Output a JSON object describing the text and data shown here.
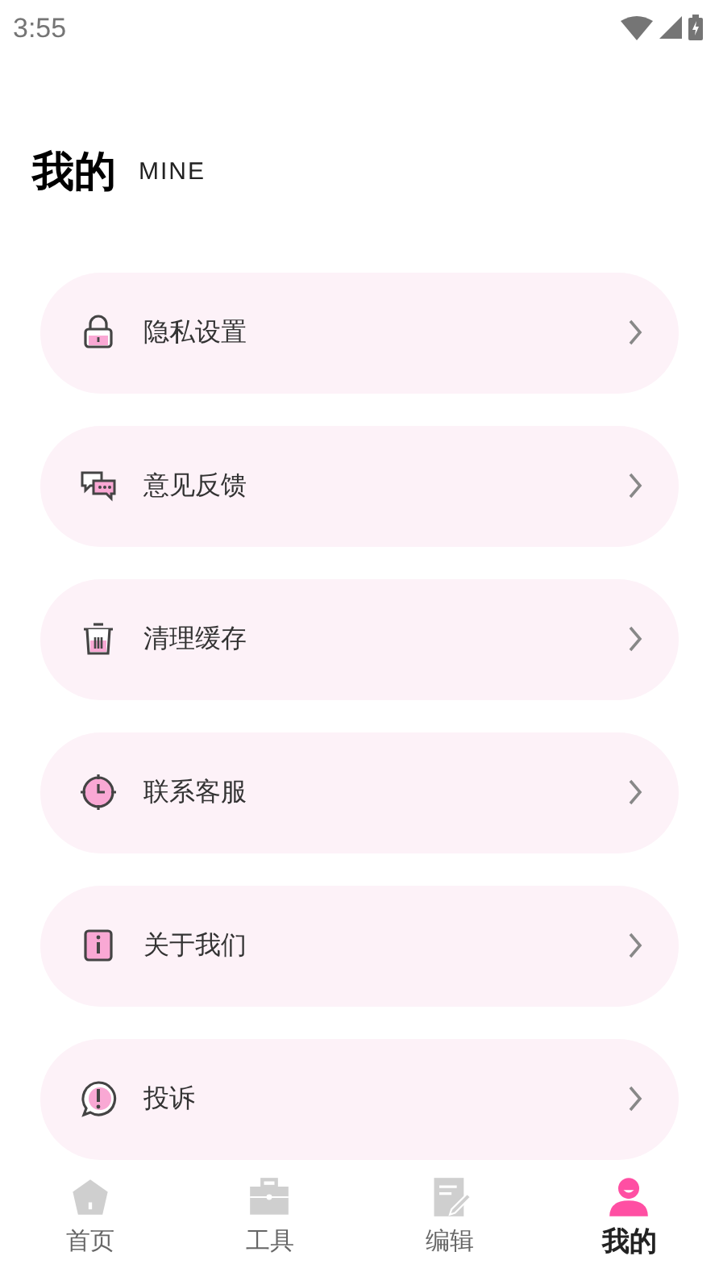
{
  "status_bar": {
    "time": "3:55"
  },
  "header": {
    "title": "我的",
    "subtitle": "MINE"
  },
  "menu": [
    {
      "label": "隐私设置"
    },
    {
      "label": "意见反馈"
    },
    {
      "label": "清理缓存"
    },
    {
      "label": "联系客服"
    },
    {
      "label": "关于我们"
    },
    {
      "label": "投诉"
    }
  ],
  "tabs": [
    {
      "label": "首页",
      "selected": false
    },
    {
      "label": "工具",
      "selected": false
    },
    {
      "label": "编辑",
      "selected": false
    },
    {
      "label": "我的",
      "selected": true
    }
  ]
}
